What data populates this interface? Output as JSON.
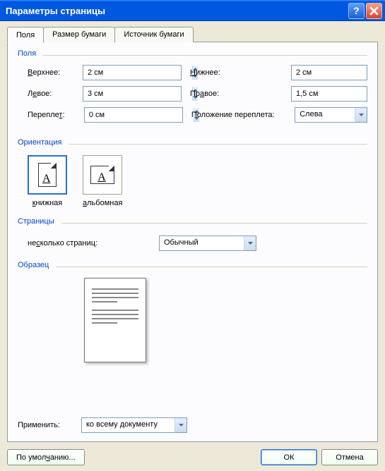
{
  "titlebar": {
    "title": "Параметры страницы"
  },
  "tabs": {
    "margins": "Поля",
    "paper": "Размер бумаги",
    "source": "Источник бумаги"
  },
  "groups": {
    "margins": "Поля",
    "orientation": "Ориентация",
    "pages": "Страницы",
    "preview": "Образец"
  },
  "margins": {
    "top_label": "Верхнее:",
    "top_value": "2 см",
    "bottom_label": "Нижнее:",
    "bottom_value": "2 см",
    "left_label": "Левое:",
    "left_value": "3 см",
    "right_label": "Правое:",
    "right_value": "1,5 см",
    "gutter_label": "Переплет:",
    "gutter_value": "0 см",
    "gutter_pos_label": "Положение переплета:",
    "gutter_pos_value": "Слева"
  },
  "orientation": {
    "portrait": "книжная",
    "landscape": "альбомная"
  },
  "pages": {
    "label": "несколько страниц:",
    "value": "Обычный"
  },
  "apply": {
    "label": "Применить:",
    "value": "ко всему документу"
  },
  "buttons": {
    "default": "По умолчанию...",
    "ok": "ОК",
    "cancel": "Отмена"
  }
}
